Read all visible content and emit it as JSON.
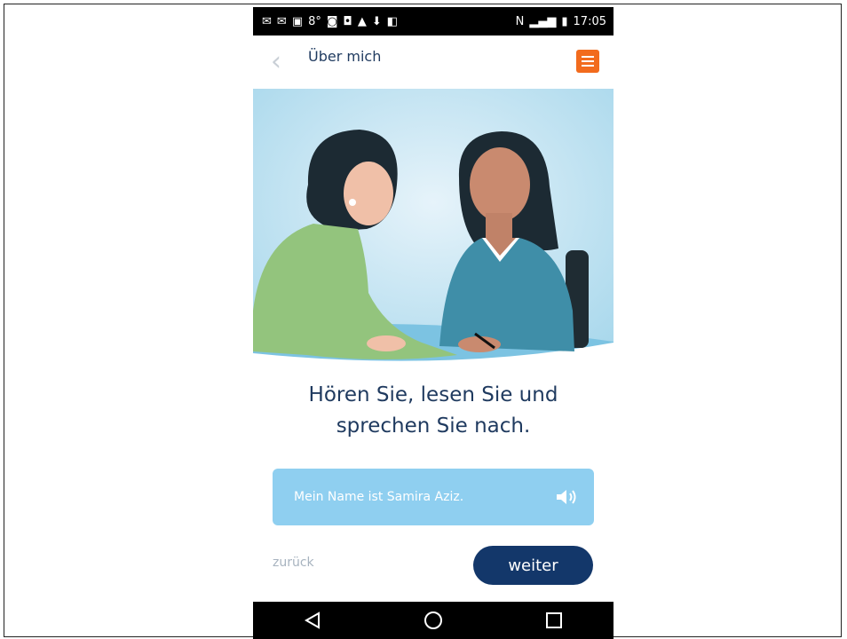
{
  "status_bar": {
    "left_icons": [
      "messenger-icon",
      "messenger-icon",
      "image-icon",
      "temperature-icon",
      "instagram-icon",
      "camera-icon",
      "navigation-icon",
      "download-icon",
      "bag-icon"
    ],
    "temperature": "8°",
    "time": "17:05"
  },
  "header": {
    "title": "Über mich"
  },
  "headline": {
    "line1": "Hören Sie, lesen Sie und",
    "line2": "sprechen Sie nach."
  },
  "audio": {
    "text": "Mein Name ist Samira Aziz."
  },
  "actions": {
    "back_label": "zurück",
    "next_label": "weiter"
  },
  "colors": {
    "accent_orange": "#f26b1d",
    "primary_navy": "#13376a",
    "audio_bg": "#8fcff0",
    "title_text": "#1f3a5f"
  }
}
